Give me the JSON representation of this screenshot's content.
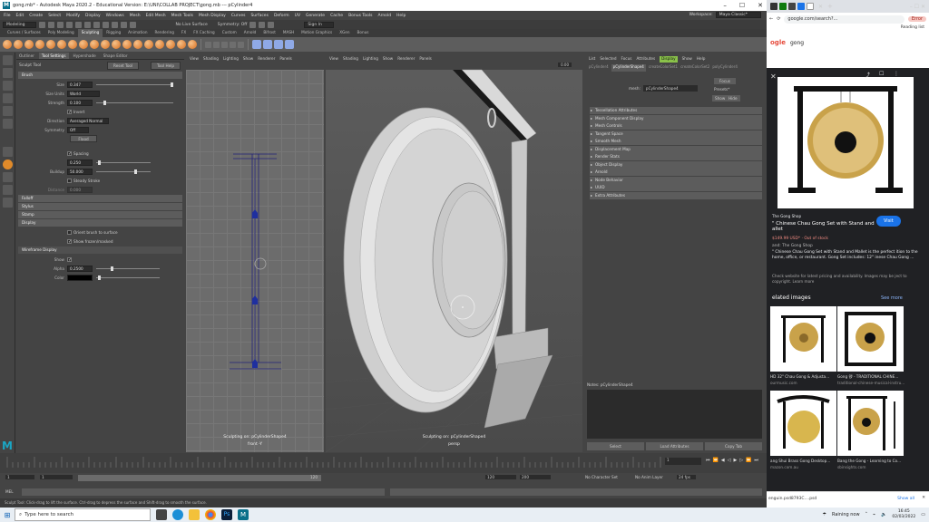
{
  "maya": {
    "window_title": "gong.mb* - Autodesk Maya 2020.2 - Educational Version: E:\\UNI\\COLLAB PROJECT\\gong.mb  ---  pCylinder4",
    "menu": [
      "File",
      "Edit",
      "Create",
      "Select",
      "Modify",
      "Display",
      "Windows",
      "Mesh",
      "Edit Mesh",
      "Mesh Tools",
      "Mesh Display",
      "Curves",
      "Surfaces",
      "Deform",
      "UV",
      "Generate",
      "Cache",
      "Bonus Tools",
      "Arnold",
      "Help"
    ],
    "workspace_label": "Workspace:",
    "workspace_value": "Maya Classic*",
    "status": {
      "mode": "Modeling",
      "surface": "No Live Surface",
      "symmetry": "Symmetry: Off",
      "sign_in": "Sign In"
    },
    "shelf_tabs": [
      "Curves / Surfaces",
      "Poly Modeling",
      "Sculpting",
      "Rigging",
      "Animation",
      "Rendering",
      "FX",
      "FX Caching",
      "Custom",
      "Arnold",
      "Bifrost",
      "MASH",
      "Motion Graphics",
      "XGen",
      "Bonus"
    ],
    "shelf_active": "Sculpting",
    "tool_settings": {
      "tabs": [
        "Outliner",
        "Tool Settings",
        "Hypershade",
        "Shape Editor"
      ],
      "tool_name": "Sculpt Tool",
      "reset_btn": "Reset Tool",
      "help_btn": "Tool Help",
      "brush_section": "Brush",
      "size_label": "Size",
      "size_value": "0.347",
      "size_units_label": "Size Units",
      "size_units_value": "World",
      "strength_label": "Strength",
      "strength_value": "0.100",
      "invert_label": "Invert",
      "direction_label": "Direction",
      "direction_value": "Averaged Normal",
      "symmetry_label": "Symmetry",
      "symmetry_value": "Off",
      "flood_btn": "Flood",
      "spacing_label": "Spacing",
      "spacing_value": "0.250",
      "buildup_label": "Buildup",
      "buildup_value": "50.000",
      "steady_label": "Steady Stroke",
      "distance_label": "Distance",
      "distance_value": "0.000",
      "sections": [
        "Falloff",
        "Stylus",
        "Stamp",
        "Display"
      ],
      "orient_label": "Orient brush to surface",
      "show_frozen_label": "Show frozen/masked",
      "wireframe_section": "Wireframe Display",
      "show_label": "Show",
      "alpha_label": "Alpha",
      "alpha_value": "0.2500",
      "color_label": "Color"
    },
    "viewport_menu": [
      "View",
      "Shading",
      "Lighting",
      "Show",
      "Renderer",
      "Panels"
    ],
    "front_caption_1": "Sculpting on: pCylinderShape4",
    "front_caption_2": "front -Y",
    "persp_caption_1": "Sculpting on: pCylinderShape4",
    "persp_caption_2": "persp",
    "persp_value": "0.00",
    "attr": {
      "menu": [
        "List",
        "Selected",
        "Focus",
        "Attributes",
        "Display",
        "Show",
        "Help"
      ],
      "menu_active": "Display",
      "tabs": [
        "pCylinder4",
        "pCylinderShape4",
        "createColorSet1",
        "createColorSet2",
        "polyCylinder4"
      ],
      "tab_active": "pCylinderShape4",
      "mesh_label": "mesh:",
      "mesh_value": "pCylinderShape4",
      "focus_btn": "Focus",
      "presets_btn": "Presets*",
      "show_btn": "Show",
      "hide_btn": "Hide",
      "sections": [
        "Tessellation Attributes",
        "Mesh Component Display",
        "Mesh Controls",
        "Tangent Space",
        "Smooth Mesh",
        "Displacement Map",
        "Render Stats",
        "Object Display",
        "Arnold",
        "Node Behavior",
        "UUID",
        "Extra Attributes"
      ],
      "notes_label": "Notes: pCylinderShape4",
      "select_btn": "Select",
      "load_btn": "Load Attributes",
      "copy_btn": "Copy Tab"
    },
    "timeline": {
      "start": "1",
      "end": "120",
      "range_start": "1",
      "range_end": "120",
      "range_end2": "200",
      "current": "1",
      "char_set": "No Character Set",
      "anim_layer": "No Anim Layer",
      "fps": "24 fps"
    },
    "mel_label": "MEL",
    "help_text": "Sculpt Tool: Click-drag to lift the surface. Ctrl-drag to depress the surface and Shift-drag to smooth the surface."
  },
  "chrome": {
    "url": "google.com/search?...",
    "reading_list": "Reading list",
    "search_query": "gong",
    "error_label": "Error",
    "shop_name": "The Gong Shop",
    "product_title": "\" Chinese Chau Gong Set with Stand and allet",
    "visit_btn": "Visit",
    "price": "$149.99 USD* · Out of stock",
    "brand": "and: The Gong Shop",
    "desc": "\" Chinese Chau Gong Set with Stand and Mallet is the perfect ition to the home, office, or restaurant. Gong Set includes: 12\" inese Chau Gong ...",
    "copyright": "Check website for latest pricing and availability. Images may be ject to copyright. Learn more",
    "related": "elated images",
    "see_more": "See more",
    "thumbs": [
      {
        "cap1": "HD 32\" Chau Gong & Adjusta...",
        "cap2": "ourmusic.com"
      },
      {
        "cap1": "Gong 锣 - TRADITIONAL CHINE...",
        "cap2": "traditional-chinese-musical-instru..."
      },
      {
        "cap1": "ang Shui Brass Gong Desktop...",
        "cap2": "mazon.com.au"
      },
      {
        "cap1": "Bang the Gong - Learning to Co...",
        "cap2": "sbinsights.com"
      }
    ],
    "download": "enguin.psd8793C....psd",
    "show_all": "Show all"
  },
  "taskbar": {
    "search_placeholder": "Type here to search",
    "weather": "Raining now",
    "time": "16:45",
    "date": "02/03/2022"
  }
}
